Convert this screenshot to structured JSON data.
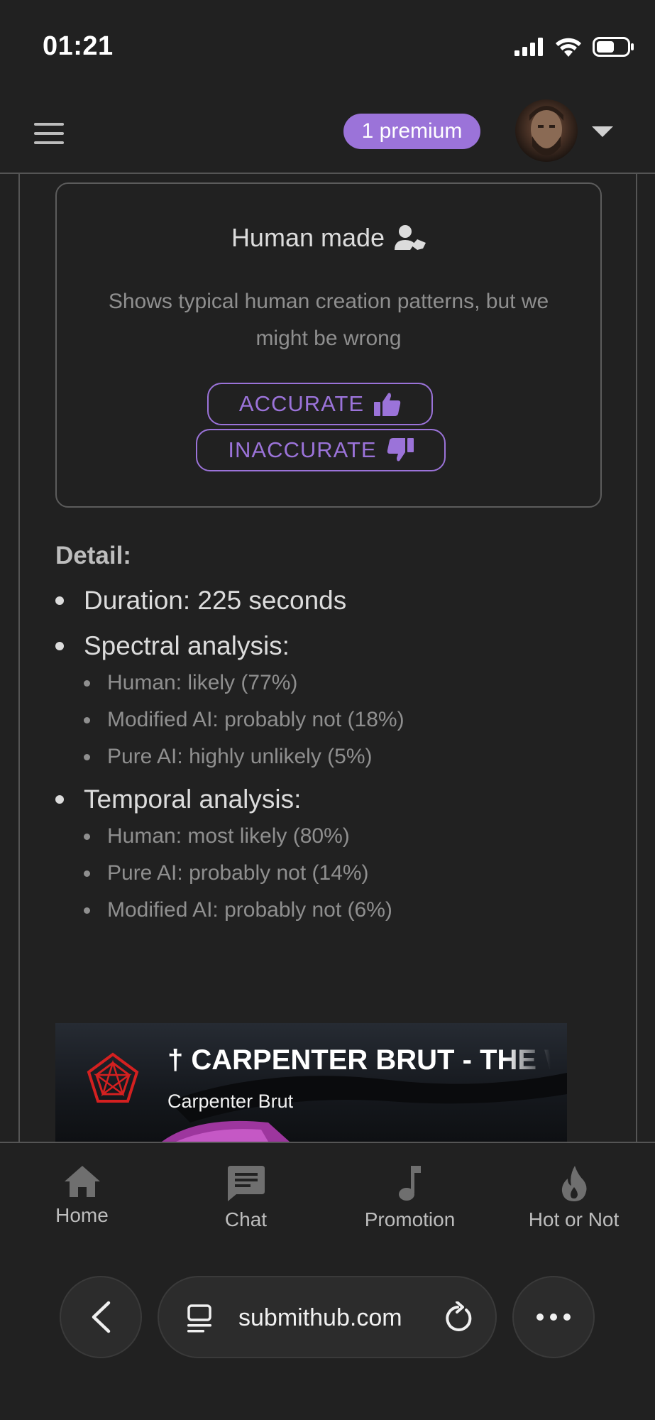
{
  "status": {
    "time": "01:21"
  },
  "header": {
    "premium_label": "1 premium"
  },
  "result": {
    "title": "Human made",
    "description": "Shows typical human creation patterns, but we might be wrong",
    "accurate_label": "ACCURATE",
    "inaccurate_label": "INACCURATE"
  },
  "detail": {
    "heading": "Detail:",
    "duration": "Duration: 225 seconds",
    "spectral": {
      "label": "Spectral analysis:",
      "items": [
        "Human: likely (77%)",
        "Modified AI: probably not (18%)",
        "Pure AI: highly unlikely (5%)"
      ]
    },
    "temporal": {
      "label": "Temporal analysis:",
      "items": [
        "Human: most likely (80%)",
        "Pure AI: probably not (14%)",
        "Modified AI: probably not (6%)"
      ]
    }
  },
  "embed": {
    "title": "† CARPENTER BRUT - THE WIDOW MAKER",
    "artist": "Carpenter Brut"
  },
  "nav": [
    {
      "label": "Home",
      "icon": "home-icon"
    },
    {
      "label": "Chat",
      "icon": "chat-icon"
    },
    {
      "label": "Promotion",
      "icon": "music-note-icon"
    },
    {
      "label": "Hot or Not",
      "icon": "flame-icon"
    }
  ],
  "browser": {
    "url": "submithub.com"
  },
  "colors": {
    "accent": "#9b73d9",
    "background": "#212121"
  }
}
